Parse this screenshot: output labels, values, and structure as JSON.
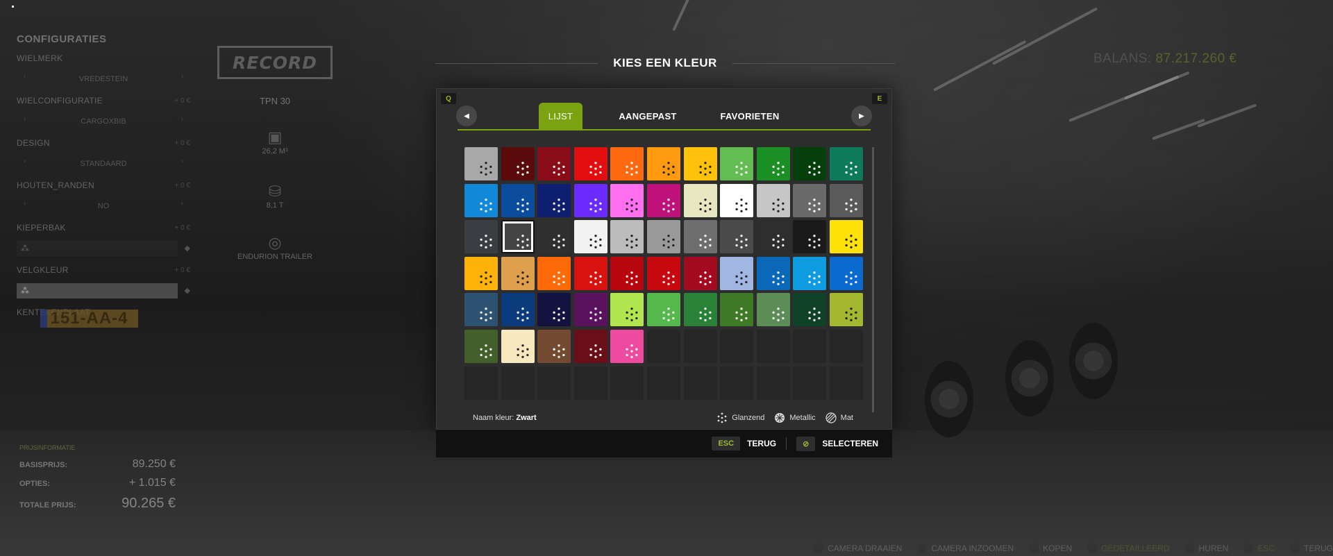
{
  "left": {
    "title": "CONFIGURATIES",
    "configs": [
      {
        "label": "WIELMERK",
        "value": "VREDESTEIN",
        "price": ""
      },
      {
        "label": "WIELCONFIGURATIE",
        "value": "CARGOXBIB",
        "price": "+ 0 €"
      },
      {
        "label": "DESIGN",
        "value": "STANDAARD",
        "price": "+ 0 €"
      },
      {
        "label": "HOUTEN_RANDEN",
        "value": "NO",
        "price": "+ 0 €"
      },
      {
        "label": "KIEPERBAK",
        "value": "",
        "price": "+ 0 €"
      },
      {
        "label": "VELGKLEUR",
        "value": "",
        "price": "+ 0 €"
      }
    ],
    "plate_label": "KENTEKENPLAAT",
    "plate": "151-AA-4"
  },
  "totals": {
    "header": "PRIJSINFORMATIE",
    "base_label": "BASISPRIJS:",
    "base_value": "89.250 €",
    "options_label": "OPTIES:",
    "options_value": "+ 1.015 €",
    "total_label": "TOTALE PRIJS:",
    "total_value": "90.265 €"
  },
  "brand": {
    "logo": "RECORD",
    "model": "TPN 30",
    "capacity": "26,2 M³",
    "weight": "8,1 T",
    "category": "ENDURION TRAILER"
  },
  "balance": {
    "label": "BALANS:",
    "amount": "87.217.260 €"
  },
  "dialog": {
    "title": "KIES EEN KLEUR",
    "key_left": "Q",
    "key_right": "E",
    "tabs": [
      "LIJST",
      "AANGEPAST",
      "FAVORIETEN"
    ],
    "name_prefix": "Naam kleur:",
    "name_value": "Zwart",
    "legend": [
      "Glanzend",
      "Metallic",
      "Mat"
    ],
    "esc_key": "ESC",
    "back_label": "TERUG",
    "select_label": "SELECTEREN"
  },
  "swatches": [
    [
      "#a8a8a8",
      "#5a0a0a",
      "#8a0c18",
      "#e30e10",
      "#ff6a10",
      "#ff9a10",
      "#ffc20a",
      "#64bd52",
      "#1b8f23",
      "#053f0b",
      "#0d7a5a"
    ],
    [
      "#1188d8",
      "#0b4d9c",
      "#0e1e70",
      "#6b2bff",
      "#ff6ff0",
      "#c0107a",
      "#e9e6c2",
      "#ffffff",
      "#c6c6c6",
      "#6a6a6a",
      "#5a5a5a"
    ],
    [
      "#3a3d42",
      "#444444",
      "#2f2f2f",
      "#f2f2f2",
      "#bcbcbc",
      "#9a9a9a",
      "#6e6e6e",
      "#4a4a4a",
      "#2e2e2e",
      "#1a1a1a",
      "#ffe20a"
    ],
    [
      "#ffb20a",
      "#dea04c",
      "#ff6a08",
      "#d8130f",
      "#b8060d",
      "#c8080f",
      "#a40a1f",
      "#a2b6e4",
      "#0b68b8",
      "#0e9ce0",
      "#0a6ad0"
    ],
    [
      "#2e5272",
      "#0c3b7d",
      "#14133f",
      "#5a125e",
      "#b2e64e",
      "#54b84a",
      "#2a8238",
      "#3e7a25",
      "#5d8d56",
      "#0f4227",
      "#a3b830"
    ],
    [
      "#43602c",
      "#f7e8c0",
      "#734a30",
      "#6a0f17",
      "#ee4aa0"
    ]
  ],
  "selected_swatch": "2-1",
  "bottom": [
    {
      "label": "CAMERA DRAAIEN",
      "dim": false
    },
    {
      "label": "CAMERA INZOOMEN",
      "dim": false
    },
    {
      "label": "KOPEN",
      "dim": false
    },
    {
      "label": "GEDETAILLEERD",
      "dim": true
    },
    {
      "label": "HUREN",
      "dim": false
    },
    {
      "label": "ESC",
      "dim": true
    },
    {
      "label": "TERUG",
      "dim": false
    }
  ]
}
